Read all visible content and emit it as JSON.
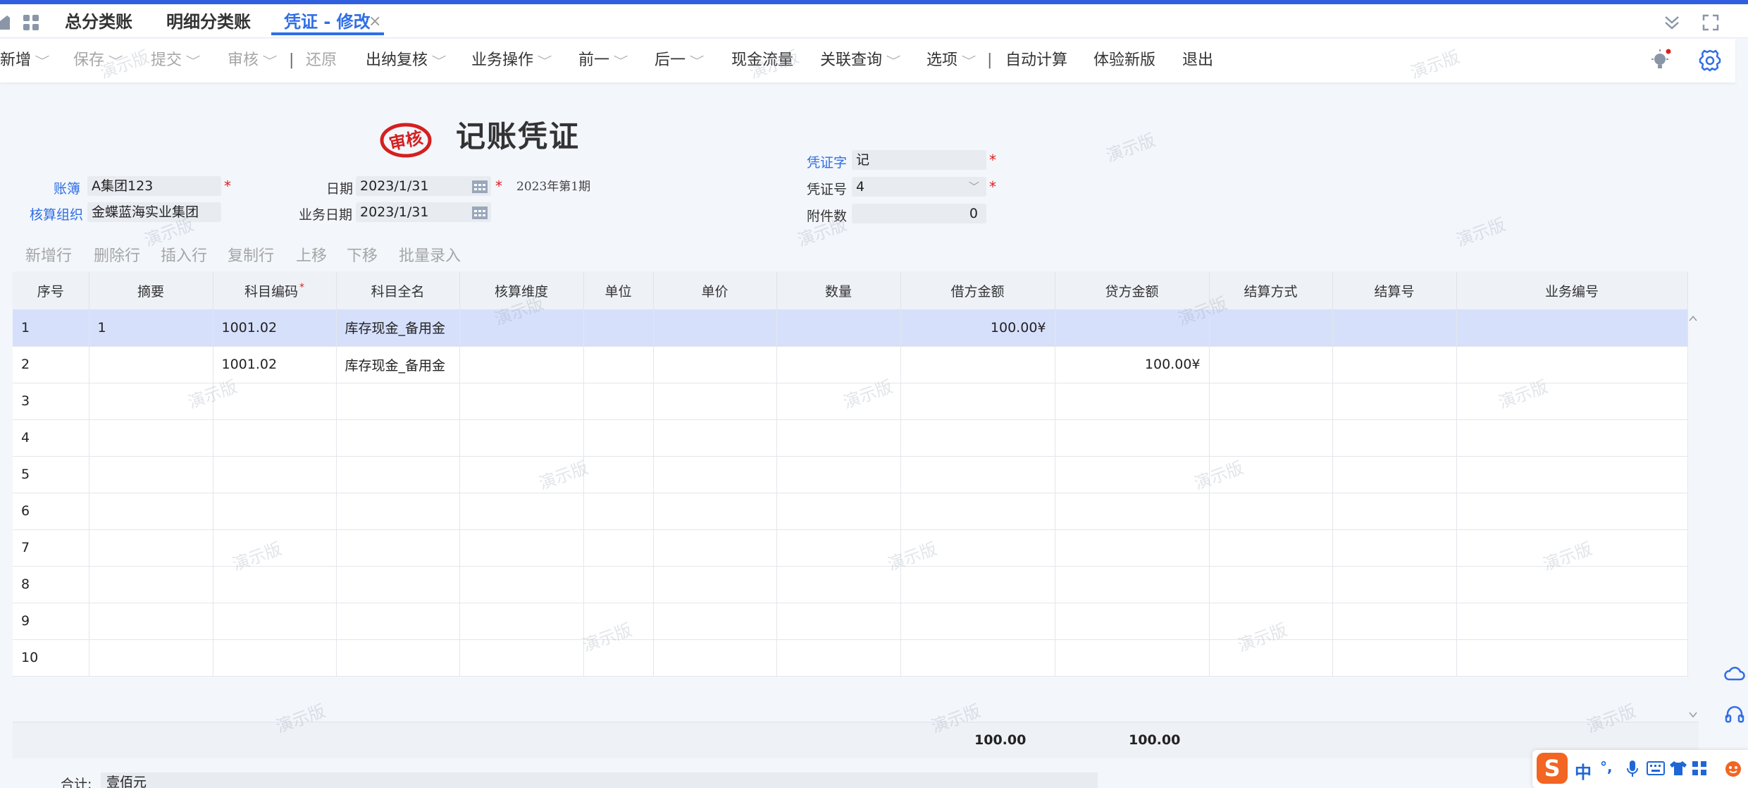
{
  "tabs": {
    "general_ledger": "总分类账",
    "detail_ledger": "明细分类账",
    "voucher_edit": "凭证 - 修改",
    "close": "×"
  },
  "toolbar": {
    "new": "新增",
    "save": "保存",
    "submit": "提交",
    "audit": "审核",
    "restore": "还原",
    "cashier_review": "出纳复核",
    "business_ops": "业务操作",
    "previous": "前一",
    "next": "后一",
    "cash_flow": "现金流量",
    "related_query": "关联查询",
    "options": "选项",
    "auto_calc": "自动计算",
    "try_new_version": "体验新版",
    "exit": "退出",
    "caret": "﹀",
    "divider": "|"
  },
  "header": {
    "stamp": "审核",
    "title": "记账凭证",
    "ledger_label": "账簿",
    "ledger_value": "A集团123",
    "org_label": "核算组织",
    "org_value": "金蝶蓝海实业集团",
    "date_label": "日期",
    "date_value": "2023/1/31",
    "biz_date_label": "业务日期",
    "biz_date_value": "2023/1/31",
    "period": "2023年第1期",
    "voucher_word_label": "凭证字",
    "voucher_word_value": "记",
    "voucher_no_label": "凭证号",
    "voucher_no_value": "4",
    "attach_label": "附件数",
    "attach_value": "0",
    "required": "*"
  },
  "row_actions": {
    "add_row": "新增行",
    "delete_row": "删除行",
    "insert_row": "插入行",
    "copy_row": "复制行",
    "move_up": "上移",
    "move_down": "下移",
    "batch_entry": "批量录入"
  },
  "table": {
    "columns": [
      "序号",
      "摘要",
      "科目编码",
      "科目全名",
      "核算维度",
      "单位",
      "单价",
      "数量",
      "借方金额",
      "贷方金额",
      "结算方式",
      "结算号",
      "业务编号"
    ],
    "rows": [
      {
        "seq": "1",
        "summary": "1",
        "code": "1001.02",
        "name": "库存现金_备用金",
        "debit": "100.00¥",
        "credit": ""
      },
      {
        "seq": "2",
        "summary": "",
        "code": "1001.02",
        "name": "库存现金_备用金",
        "debit": "",
        "credit": "100.00¥"
      },
      {
        "seq": "3",
        "summary": "",
        "code": "",
        "name": "",
        "debit": "",
        "credit": ""
      },
      {
        "seq": "4",
        "summary": "",
        "code": "",
        "name": "",
        "debit": "",
        "credit": ""
      },
      {
        "seq": "5",
        "summary": "",
        "code": "",
        "name": "",
        "debit": "",
        "credit": ""
      },
      {
        "seq": "6",
        "summary": "",
        "code": "",
        "name": "",
        "debit": "",
        "credit": ""
      },
      {
        "seq": "7",
        "summary": "",
        "code": "",
        "name": "",
        "debit": "",
        "credit": ""
      },
      {
        "seq": "8",
        "summary": "",
        "code": "",
        "name": "",
        "debit": "",
        "credit": ""
      },
      {
        "seq": "9",
        "summary": "",
        "code": "",
        "name": "",
        "debit": "",
        "credit": ""
      },
      {
        "seq": "10",
        "summary": "",
        "code": "",
        "name": "",
        "debit": "",
        "credit": ""
      }
    ],
    "total_debit": "100.00",
    "total_credit": "100.00"
  },
  "footer": {
    "total_label": "合计:",
    "total_words": "壹佰元"
  },
  "watermark": "演示版",
  "ime": {
    "logo": "S",
    "lang": "中",
    "punct": "°,"
  },
  "colors": {
    "accent": "#2f6ee6",
    "top_bar": "#2f5fe0",
    "required": "#e02020",
    "stamp": "#d42020",
    "selected_row": "#d6e0fb"
  }
}
